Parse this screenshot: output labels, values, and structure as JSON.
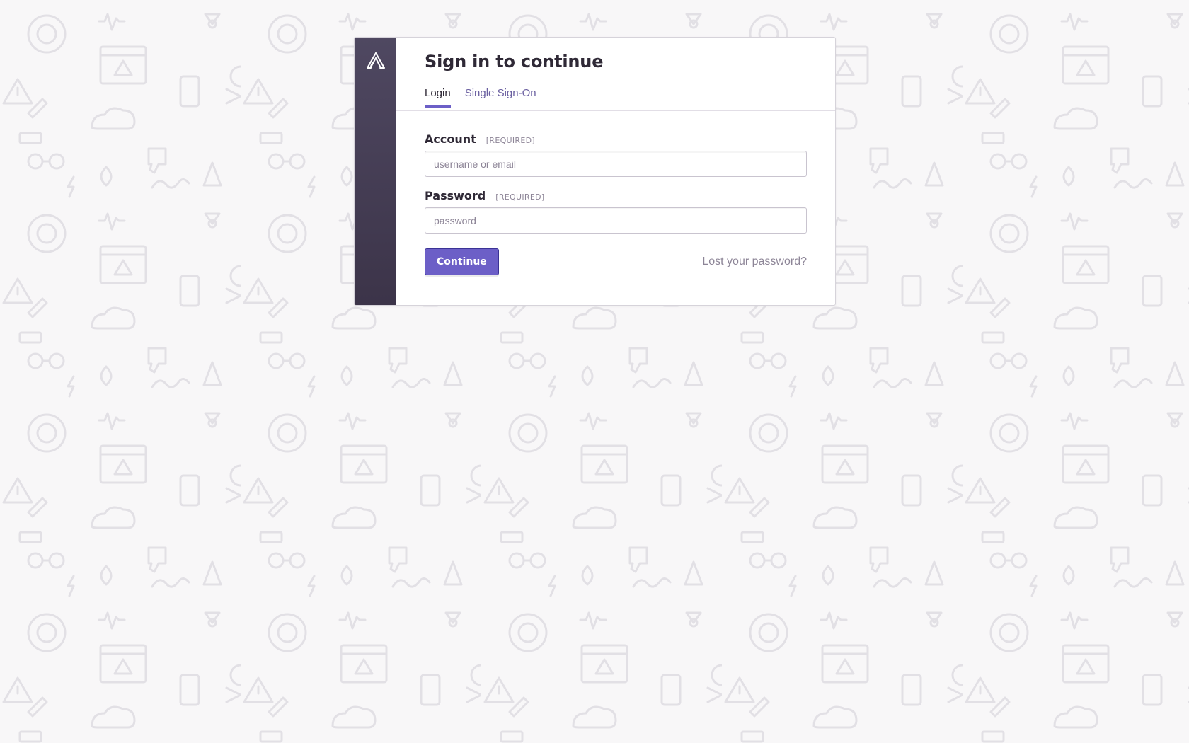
{
  "auth": {
    "title": "Sign in to continue",
    "tabs": [
      {
        "label": "Login",
        "active": true
      },
      {
        "label": "Single Sign-On",
        "active": false
      }
    ],
    "account": {
      "label": "Account",
      "required": "[REQUIRED]",
      "placeholder": "username or email",
      "value": ""
    },
    "password": {
      "label": "Password",
      "required": "[REQUIRED]",
      "placeholder": "password",
      "value": ""
    },
    "continue_label": "Continue",
    "lost_password_label": "Lost your password?"
  },
  "colors": {
    "accent": "#6c5fc7",
    "sidebar_top": "#4f4861",
    "sidebar_bottom": "#3c3449",
    "page_bg": "#f8f7f8",
    "pattern": "#e4e2e6"
  },
  "icons": {
    "logo": "sentry-logo-icon",
    "background": "decorative-icon-pattern"
  }
}
